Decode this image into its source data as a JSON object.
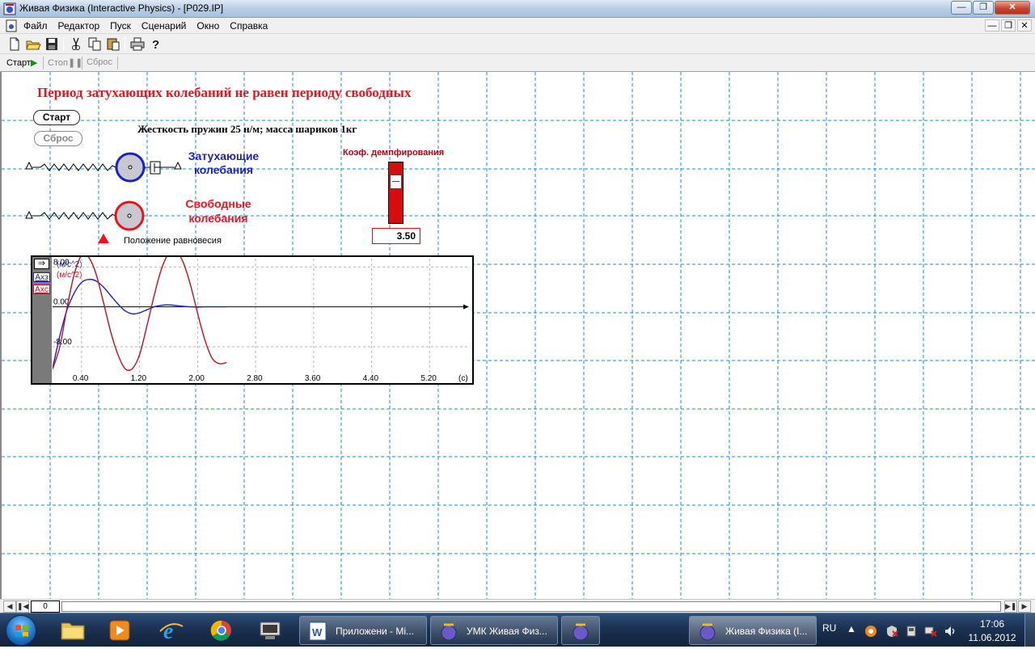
{
  "window": {
    "title": "Живая Физика (Interactive Physics) - [P029.IP]"
  },
  "menu": [
    "Файл",
    "Редактор",
    "Пуск",
    "Сценарий",
    "Окно",
    "Справка"
  ],
  "toolbar_icons": [
    "new-file-icon",
    "open-folder-icon",
    "save-icon",
    "cut-icon",
    "copy-icon",
    "paste-icon",
    "print-icon",
    "help-icon"
  ],
  "controls": {
    "start": "Старт",
    "stop": "Стоп",
    "reset": "Сброс"
  },
  "workspace": {
    "heading": "Период затухающих колебаний не равен периоду свободных",
    "start_button": "Старт",
    "reset_button": "Сброс",
    "params": "Жесткость пружин 25 н/м; масса шариков 1кг",
    "damped_label": [
      "Затухающие",
      "колебания"
    ],
    "free_label": [
      "Свободные",
      "колебания"
    ],
    "equilibrium_label": "Положение равновесия",
    "slider": {
      "title": "Коэф. демпфирования",
      "value": "3.50",
      "level": 0.25
    }
  },
  "graph": {
    "legend": [
      {
        "abbr": "Axз",
        "unit": "(м/с^2)",
        "color": "#1a21c8"
      },
      {
        "abbr": "Axc",
        "unit": "(м/с^2)",
        "color": "#c0101e"
      }
    ],
    "x_unit": "(c)"
  },
  "chart_data": {
    "type": "line",
    "xlim": [
      0,
      5.72
    ],
    "ylim": [
      -13.2,
      10
    ],
    "x_ticks": [
      "0.40",
      "1.20",
      "2.00",
      "2.80",
      "3.60",
      "4.40",
      "5.20"
    ],
    "x_tick_values": [
      0.4,
      1.2,
      2.0,
      2.8,
      3.6,
      4.4,
      5.2
    ],
    "y_ticks": [
      "8.00",
      "0.00",
      "-8.00"
    ],
    "y_tick_values": [
      8,
      0,
      -8
    ],
    "series": [
      {
        "name": "Axз",
        "color": "#1a21c8",
        "x": [
          0,
          0.1,
          0.2,
          0.3,
          0.4,
          0.5,
          0.6,
          0.7,
          0.8,
          0.9,
          1.0,
          1.1,
          1.2,
          1.3,
          1.4,
          1.5,
          1.6,
          1.7,
          1.8,
          1.9,
          2.0,
          2.1,
          2.2,
          2.3,
          2.4
        ],
        "y": [
          -12.4,
          -5.8,
          -0.6,
          2.8,
          4.9,
          5.5,
          5.2,
          4.0,
          2.3,
          0.6,
          -0.8,
          -1.4,
          -1.2,
          -0.6,
          0,
          0.3,
          0.4,
          0.25,
          0.1,
          0,
          -0.05,
          0,
          0,
          0,
          0
        ]
      },
      {
        "name": "Axc",
        "color": "#c0101e",
        "x": [
          0,
          0.1,
          0.2,
          0.3,
          0.4,
          0.5,
          0.6,
          0.7,
          0.8,
          0.9,
          1.0,
          1.1,
          1.2,
          1.3,
          1.4,
          1.5,
          1.6,
          1.7,
          1.8,
          1.9,
          2.0,
          2.1,
          2.2,
          2.3,
          2.4
        ],
        "y": [
          -12.5,
          -8.0,
          -0.2,
          6.6,
          10.3,
          9.9,
          6.6,
          1.0,
          -4.9,
          -9.5,
          -12.4,
          -12.4,
          -9.6,
          -3.9,
          2.2,
          7.5,
          10.7,
          11.2,
          9.0,
          4.5,
          -1.3,
          -6.6,
          -10.3,
          -11.4,
          -11.2
        ]
      }
    ]
  },
  "scrollbar": {
    "frame": "0"
  },
  "taskbar": {
    "pinned": [
      "explorer-icon",
      "media-player-icon",
      "internet-explorer-icon",
      "chrome-icon",
      "network-icon"
    ],
    "tasks": [
      {
        "label": "Приложени - Mi...",
        "icon": "word-icon"
      },
      {
        "label": "УМК Живая Физ...",
        "icon": "physics-app-icon"
      },
      {
        "label": "",
        "icon": "physics-app-icon"
      },
      {
        "label": "Живая Физика (I...",
        "icon": "physics-app-icon"
      }
    ],
    "lang": "RU",
    "time": "17:06",
    "date": "11.06.2012"
  }
}
